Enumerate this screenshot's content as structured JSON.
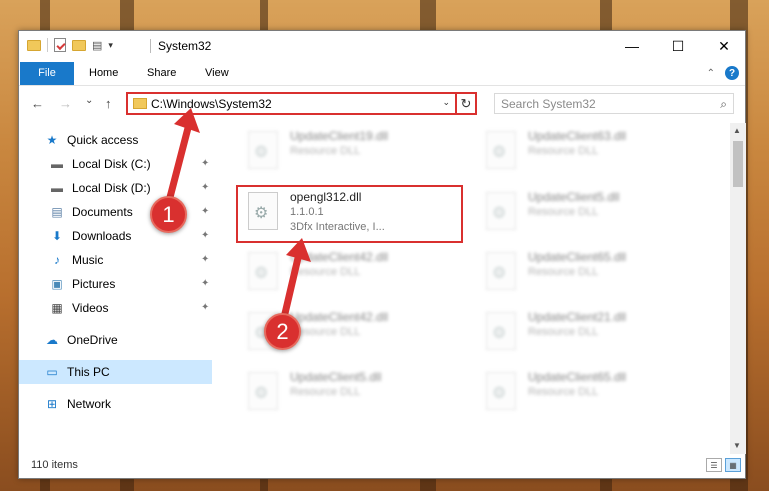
{
  "window": {
    "title": "System32",
    "controls": {
      "minimize": "—",
      "maximize": "☐",
      "close": "✕"
    }
  },
  "ribbon": {
    "tabs": [
      "File",
      "Home",
      "Share",
      "View"
    ],
    "collapse_glyph": "⌃",
    "help_glyph": "?"
  },
  "nav": {
    "back": "←",
    "forward": "→",
    "recent": "⌄",
    "up": "↑",
    "address": "C:\\Windows\\System32",
    "address_drop": "⌄",
    "refresh": "↻",
    "search_placeholder": "Search System32",
    "search_glyph": "⌕"
  },
  "sidebar": {
    "items": [
      {
        "label": "Quick access",
        "icon": "star-icon",
        "glyph": "★",
        "pinned": false
      },
      {
        "label": "Local Disk (C:)",
        "icon": "drive-icon",
        "glyph": "▬",
        "pinned": true
      },
      {
        "label": "Local Disk (D:)",
        "icon": "drive-icon",
        "glyph": "▬",
        "pinned": true
      },
      {
        "label": "Documents",
        "icon": "documents-icon",
        "glyph": "▤",
        "pinned": true
      },
      {
        "label": "Downloads",
        "icon": "download-icon",
        "glyph": "⬇",
        "pinned": true
      },
      {
        "label": "Music",
        "icon": "music-icon",
        "glyph": "♪",
        "pinned": true
      },
      {
        "label": "Pictures",
        "icon": "pictures-icon",
        "glyph": "▣",
        "pinned": true
      },
      {
        "label": "Videos",
        "icon": "videos-icon",
        "glyph": "▦",
        "pinned": true
      },
      {
        "label": "OneDrive",
        "icon": "cloud-icon",
        "glyph": "☁",
        "pinned": false
      },
      {
        "label": "This PC",
        "icon": "computer-icon",
        "glyph": "▭",
        "pinned": false,
        "selected": true
      },
      {
        "label": "Network",
        "icon": "network-icon",
        "glyph": "⊞",
        "pinned": false
      }
    ],
    "pin_glyph": "📌"
  },
  "files": {
    "left": [
      {
        "name": "UpdateClient19.dll",
        "desc": "Resource DLL"
      },
      {
        "name": "opengl312.dll",
        "desc": "1.1.0.1",
        "extra": "3Dfx Interactive, I...",
        "highlighted": true
      },
      {
        "name": "UpdateClient42.dll",
        "desc": "Resource DLL"
      },
      {
        "name": "UpdateClient42.dll",
        "desc": "Resource DLL"
      },
      {
        "name": "UpdateClient5.dll",
        "desc": "Resource DLL"
      }
    ],
    "right": [
      {
        "name": "UpdateClient63.dll",
        "desc": "Resource DLL"
      },
      {
        "name": "UpdateClient5.dll",
        "desc": "Resource DLL"
      },
      {
        "name": "UpdateClient65.dll",
        "desc": "Resource DLL"
      },
      {
        "name": "UpdateClient21.dll",
        "desc": "Resource DLL"
      },
      {
        "name": "UpdateClient65.dll",
        "desc": "Resource DLL"
      }
    ]
  },
  "status": {
    "item_count": "110 items"
  },
  "annotations": {
    "badge1": "1",
    "badge2": "2",
    "color": "#d9302f"
  }
}
